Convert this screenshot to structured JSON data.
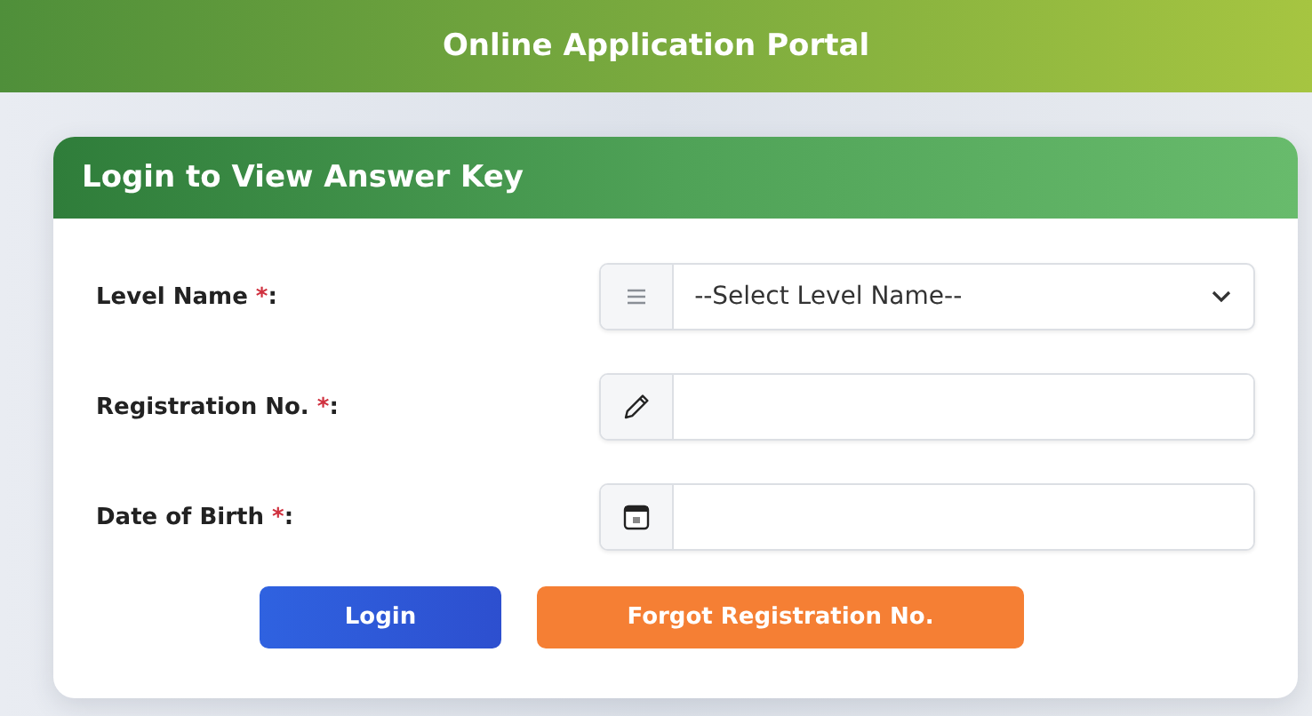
{
  "header": {
    "title": "Online Application Portal"
  },
  "card": {
    "title": "Login to View Answer Key"
  },
  "fields": [
    {
      "kind": "select",
      "label": "Level Name",
      "required_mark": "*",
      "suffix": ":",
      "value": "--Select Level Name--"
    },
    {
      "kind": "text",
      "label": "Registration No.",
      "required_mark": "*",
      "suffix": ":"
    },
    {
      "kind": "date",
      "label": "Date of Birth",
      "required_mark": "*",
      "suffix": ":"
    }
  ],
  "buttons": [
    {
      "kind": "primary",
      "label": "Login"
    },
    {
      "kind": "warning",
      "label": "Forgot Registration No."
    }
  ]
}
